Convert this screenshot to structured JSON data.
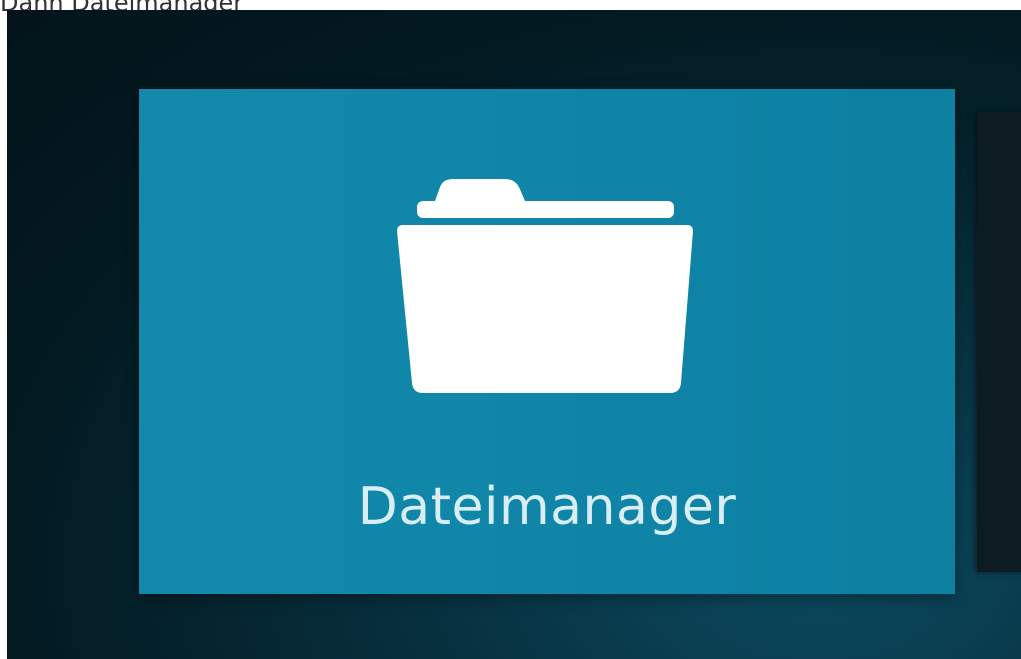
{
  "caption": "Dann Dateimanager",
  "tile": {
    "label": "Dateimanager",
    "icon": "folder-icon",
    "color": "#1289ab"
  },
  "background": {
    "colors": [
      "#021419",
      "#0c4a60"
    ]
  }
}
